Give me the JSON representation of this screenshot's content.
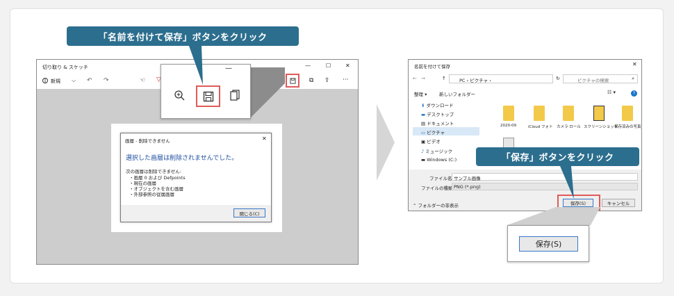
{
  "left": {
    "callout": "「名前を付けて保存」ボタンをクリック",
    "app_title": "切り取り & スケッチ",
    "new_label": "新規",
    "window_controls": {
      "min": "—",
      "max": "☐",
      "close": "✕"
    },
    "dialog": {
      "title": "画層 - 削除できません",
      "heading": "選択した画層は削除されませんでした。",
      "intro": "次の画層は削除できません:",
      "items": [
        "・画層 0 および Defpoints",
        "・現在の画層",
        "・オブジェクトを含む画層",
        "・外部参照の従属画層"
      ],
      "close_button": "閉じる(C)"
    }
  },
  "right": {
    "dialog_title": "名前を付けて保存",
    "breadcrumb": "PC › ピクチャ ›",
    "search_placeholder": "ピクチャの検索",
    "organize": "整理 ▾",
    "new_folder": "新しいフォルダー",
    "nav_items": [
      "ダウンロード",
      "デスクトップ",
      "ドキュメント",
      "ピクチャ",
      "ビデオ",
      "ミュージック",
      "Windows (C:)"
    ],
    "folders": [
      "2020-09",
      "iCloud フォト",
      "カメラ ロール",
      "スクリーンショット",
      "保存済みの写真"
    ],
    "filename_label": "ファイル名(N):",
    "filename_value": "サンプル画像",
    "filetype_label": "ファイルの種類(T):",
    "filetype_value": "PNG (*.png)",
    "hide_folders": "フォルダーの非表示",
    "save_button": "保存(S)",
    "cancel_button": "キャンセル",
    "callout": "「保存」ボタンをクリック",
    "zoom_save": "保存(S)"
  }
}
